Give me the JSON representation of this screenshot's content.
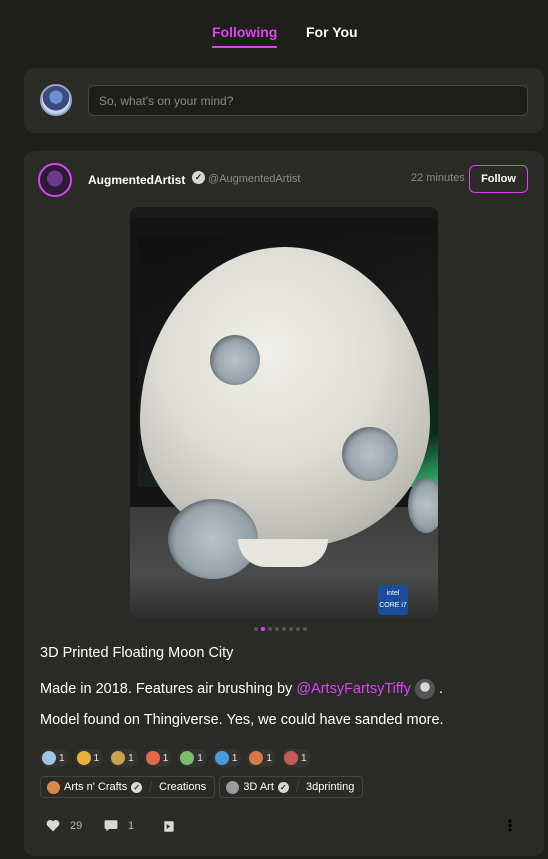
{
  "tabs": {
    "following": "Following",
    "for_you": "For You"
  },
  "compose": {
    "placeholder": "So, what's on your mind?"
  },
  "post": {
    "author": "AugmentedArtist",
    "handle": "@AugmentedArtist",
    "time": "22 minutes",
    "follow_label": "Follow",
    "carousel": {
      "total": 8,
      "active": 2
    },
    "title": "3D Printed Floating Moon City",
    "body_prefix": "Made in 2018. Features air brushing by ",
    "mention": "@ArtsyFartsyTiffy",
    "body_suffix": ".",
    "body2": "Model found on Thingiverse. Yes, we could have sanded more.",
    "intel_label": "intel CORE i7",
    "reactions": [
      {
        "icon": "bubble-emoji-icon",
        "count": "1",
        "color": "#9fc4e8"
      },
      {
        "icon": "crab-emoji-icon",
        "count": "1",
        "color": "#e8b13a"
      },
      {
        "icon": "pineapple-emoji-icon",
        "count": "1",
        "color": "#c9a24a"
      },
      {
        "icon": "octopus-emoji-icon",
        "count": "1",
        "color": "#e26a4a"
      },
      {
        "icon": "frog-emoji-icon",
        "count": "1",
        "color": "#7bbf6a"
      },
      {
        "icon": "earth-emoji-icon",
        "count": "1",
        "color": "#4a9ad8"
      },
      {
        "icon": "bear-emoji-icon",
        "count": "1",
        "color": "#d9794a"
      },
      {
        "icon": "raccoon-emoji-icon",
        "count": "1",
        "color": "#c45a5a"
      }
    ],
    "tags": [
      {
        "group": "Arts n' Crafts",
        "name": "Creations",
        "icon_color": "#d98a4a"
      },
      {
        "group": "3D Art",
        "name": "3dprinting",
        "icon_color": "#9a9a9a"
      }
    ],
    "likes": "29",
    "comments": "1"
  }
}
